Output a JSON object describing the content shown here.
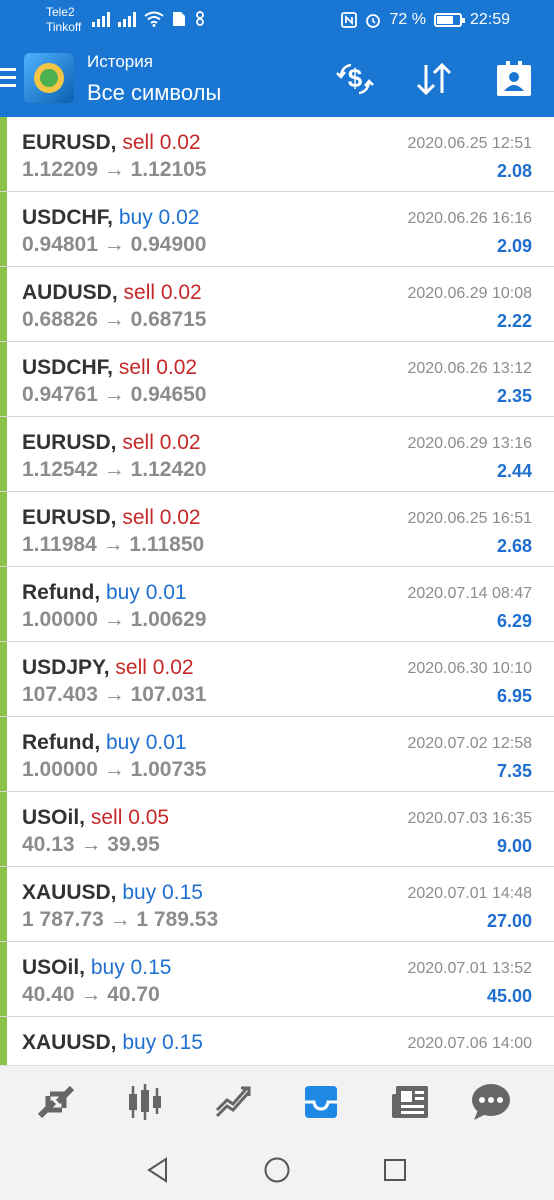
{
  "status_bar": {
    "carrier1": "Tele2",
    "carrier2": "Tinkoff",
    "battery": "72 %",
    "battery_level": 0.72,
    "time": "22:59"
  },
  "toolbar": {
    "subtitle": "История",
    "title": "Все символы"
  },
  "trades": [
    {
      "symbol": "EURUSD,",
      "side": "sell",
      "volume": "sell 0.02",
      "prices": "1.12209 → 1.12105",
      "datetime": "2020.06.25 12:51",
      "profit": "2.08"
    },
    {
      "symbol": "USDCHF,",
      "side": "buy",
      "volume": "buy 0.02",
      "prices": "0.94801 → 0.94900",
      "datetime": "2020.06.26 16:16",
      "profit": "2.09"
    },
    {
      "symbol": "AUDUSD,",
      "side": "sell",
      "volume": "sell 0.02",
      "prices": "0.68826 → 0.68715",
      "datetime": "2020.06.29 10:08",
      "profit": "2.22"
    },
    {
      "symbol": "USDCHF,",
      "side": "sell",
      "volume": "sell 0.02",
      "prices": "0.94761 → 0.94650",
      "datetime": "2020.06.26 13:12",
      "profit": "2.35"
    },
    {
      "symbol": "EURUSD,",
      "side": "sell",
      "volume": "sell 0.02",
      "prices": "1.12542 → 1.12420",
      "datetime": "2020.06.29 13:16",
      "profit": "2.44"
    },
    {
      "symbol": "EURUSD,",
      "side": "sell",
      "volume": "sell 0.02",
      "prices": "1.11984 → 1.11850",
      "datetime": "2020.06.25 16:51",
      "profit": "2.68"
    },
    {
      "symbol": "Refund,",
      "side": "buy",
      "volume": "buy 0.01",
      "prices": "1.00000 → 1.00629",
      "datetime": "2020.07.14 08:47",
      "profit": "6.29"
    },
    {
      "symbol": "USDJPY,",
      "side": "sell",
      "volume": "sell 0.02",
      "prices": "107.403 → 107.031",
      "datetime": "2020.06.30 10:10",
      "profit": "6.95"
    },
    {
      "symbol": "Refund,",
      "side": "buy",
      "volume": "buy 0.01",
      "prices": "1.00000 → 1.00735",
      "datetime": "2020.07.02 12:58",
      "profit": "7.35"
    },
    {
      "symbol": "USOil,",
      "side": "sell",
      "volume": "sell 0.05",
      "prices": "40.13 → 39.95",
      "datetime": "2020.07.03 16:35",
      "profit": "9.00"
    },
    {
      "symbol": "XAUUSD,",
      "side": "buy",
      "volume": "buy 0.15",
      "prices": "1 787.73 → 1 789.53",
      "datetime": "2020.07.01 14:48",
      "profit": "27.00"
    },
    {
      "symbol": "USOil,",
      "side": "buy",
      "volume": "buy 0.15",
      "prices": "40.40 → 40.70",
      "datetime": "2020.07.01 13:52",
      "profit": "45.00"
    },
    {
      "symbol": "XAUUSD,",
      "side": "buy",
      "volume": "buy 0.15",
      "prices": "",
      "datetime": "2020.07.06 14:00",
      "profit": ""
    }
  ],
  "bottom_nav": [
    {
      "icon": "quotes-icon",
      "active": false
    },
    {
      "icon": "chart-icon",
      "active": false
    },
    {
      "icon": "trade-icon",
      "active": false
    },
    {
      "icon": "history-icon",
      "active": true
    },
    {
      "icon": "news-icon",
      "active": false
    },
    {
      "icon": "chat-icon",
      "active": false
    }
  ],
  "colors": {
    "primary": "#1976d2",
    "sell": "#c62828",
    "buy": "#1e6fd0",
    "profit": "#1e6fd0",
    "row_bar": "#8bc34a",
    "muted": "#8c8c8c"
  }
}
